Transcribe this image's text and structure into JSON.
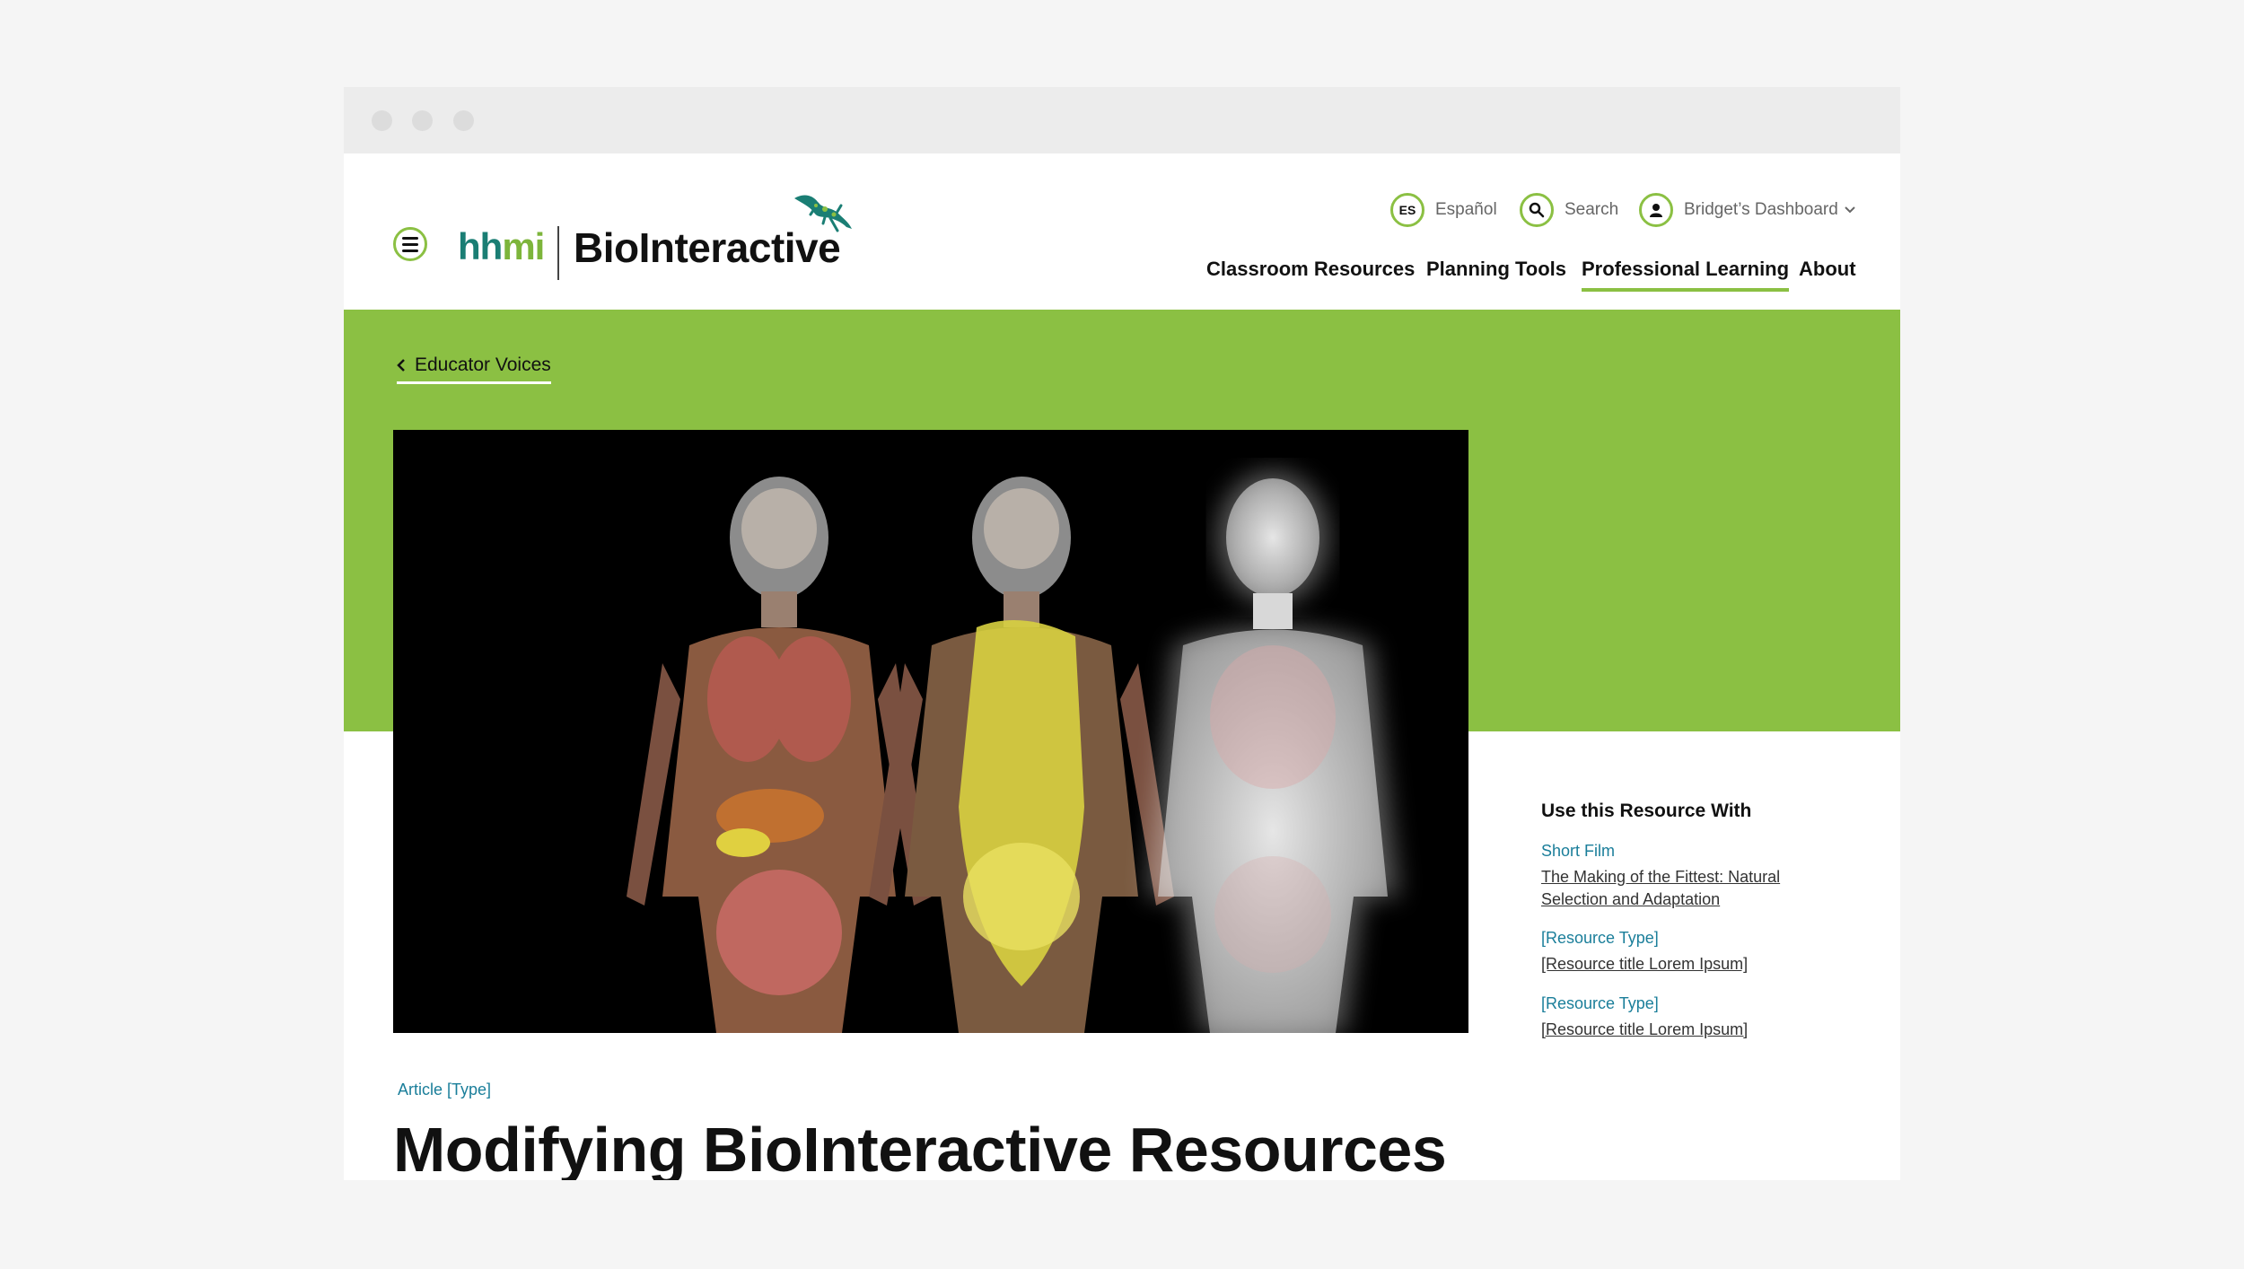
{
  "logo": {
    "hhmi_part1": "hh",
    "hhmi_part2": "mi",
    "name": "BioInteractive"
  },
  "utility": {
    "language_badge": "ES",
    "language_label": "Español",
    "search_label": "Search",
    "dashboard_label": "Bridget’s Dashboard"
  },
  "nav": {
    "items": [
      "Classroom Resources",
      "Planning Tools",
      "Professional Learning",
      "About"
    ],
    "active": "Professional Learning"
  },
  "breadcrumb": {
    "back_label": "Educator Voices"
  },
  "sidebar": {
    "title": "Use this Resource With",
    "items": [
      {
        "type": "Short Film",
        "title": "The Making of the Fittest: Natural Selection and Adaptation"
      },
      {
        "type": "[Resource Type]",
        "title": "[Resource title Lorem Ipsum]"
      },
      {
        "type": "[Resource Type]",
        "title": "[Resource title Lorem Ipsum]"
      }
    ]
  },
  "article": {
    "type_label": "Article [Type]",
    "title": "Modifying BioInteractive Resources"
  },
  "colors": {
    "brand_green": "#8bc043",
    "teal": "#1a7e74",
    "link_blue": "#1a7e9a"
  }
}
